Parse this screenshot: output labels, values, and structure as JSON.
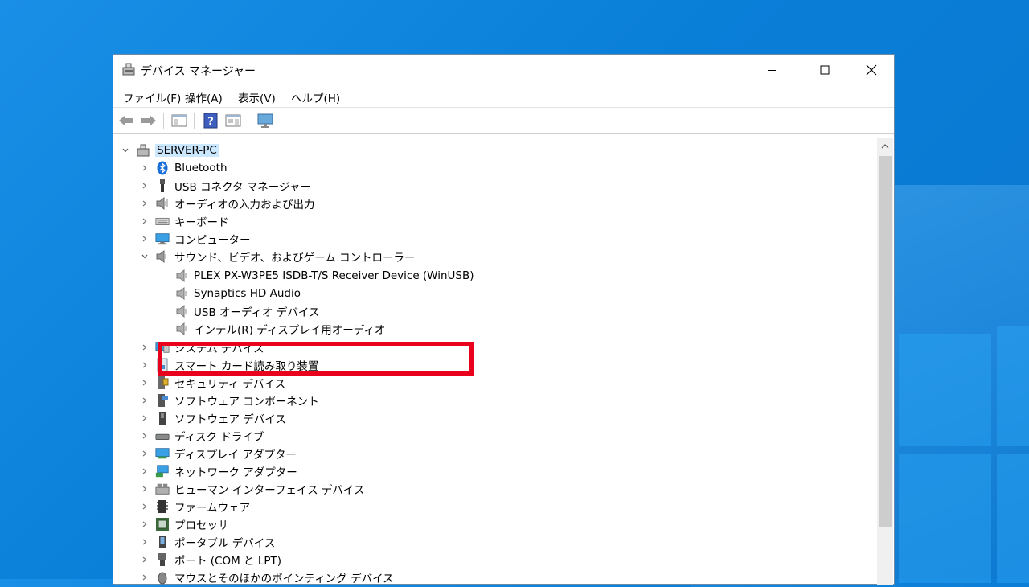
{
  "window": {
    "title": "デバイス マネージャー"
  },
  "menu": [
    "ファイル(F)",
    "操作(A)",
    "表示(V)",
    "ヘルプ(H)"
  ],
  "tree": {
    "root": "SERVER-PC",
    "categories_top": [
      {
        "label": "Bluetooth",
        "icon": "bluetooth-icon"
      },
      {
        "label": "USB コネクタ マネージャー",
        "icon": "usb-connector-icon"
      },
      {
        "label": "オーディオの入力および出力",
        "icon": "speaker-icon"
      },
      {
        "label": "キーボード",
        "icon": "keyboard-icon"
      },
      {
        "label": "コンピューター",
        "icon": "monitor-icon"
      }
    ],
    "expanded_category": {
      "label": "サウンド、ビデオ、およびゲーム コントローラー",
      "icon": "speaker-icon"
    },
    "children": [
      {
        "label": "PLEX PX-W3PE5 ISDB-T/S Receiver Device (WinUSB)",
        "icon": "speaker-icon"
      },
      {
        "label": "Synaptics HD Audio",
        "icon": "speaker-icon"
      },
      {
        "label": "USB オーディオ デバイス",
        "icon": "speaker-icon"
      },
      {
        "label": "インテル(R) ディスプレイ用オーディオ",
        "icon": "speaker-icon"
      }
    ],
    "categories_bottom": [
      {
        "label": "システム デバイス",
        "icon": "system-device-icon"
      },
      {
        "label": "スマート カード読み取り装置",
        "icon": "smart-card-icon"
      },
      {
        "label": "セキュリティ デバイス",
        "icon": "security-device-icon"
      },
      {
        "label": "ソフトウェア コンポーネント",
        "icon": "software-component-icon"
      },
      {
        "label": "ソフトウェア デバイス",
        "icon": "software-device-icon"
      },
      {
        "label": "ディスク ドライブ",
        "icon": "disk-drive-icon"
      },
      {
        "label": "ディスプレイ アダプター",
        "icon": "display-adapter-icon"
      },
      {
        "label": "ネットワーク アダプター",
        "icon": "network-adapter-icon"
      },
      {
        "label": "ヒューマン インターフェイス デバイス",
        "icon": "hid-icon"
      },
      {
        "label": "ファームウェア",
        "icon": "firmware-icon"
      },
      {
        "label": "プロセッサ",
        "icon": "processor-icon"
      },
      {
        "label": "ポータブル デバイス",
        "icon": "portable-device-icon"
      },
      {
        "label": "ポート (COM と LPT)",
        "icon": "port-icon"
      },
      {
        "label": "マウスとそのほかのポインティング デバイス",
        "icon": "mouse-icon"
      }
    ]
  },
  "colors": {
    "highlight_border": "#e8001c",
    "root_selection": "#cce8ff",
    "desktop_blue": "#0b78d4"
  }
}
